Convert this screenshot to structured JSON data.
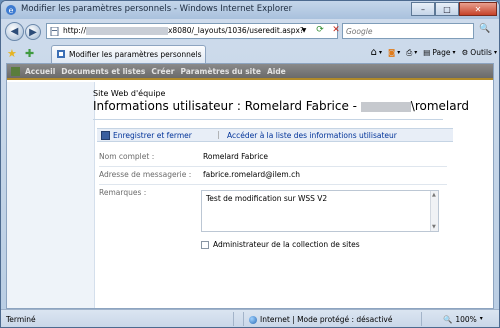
{
  "window": {
    "title": "Modifier les paramètres personnels - Windows Internet Explorer",
    "minimize_glyph": "–",
    "maximize_glyph": "□",
    "close_glyph": "✕"
  },
  "address_bar": {
    "url_prefix": "http://",
    "url_suffix": "x8080/_layouts/1036/useredit.aspx?",
    "search_placeholder": "Google"
  },
  "tab": {
    "label": "Modifier les paramètres personnels"
  },
  "tools": {
    "page": "Page",
    "tools": "Outils"
  },
  "top_nav": {
    "items": [
      "Accueil",
      "Documents et listes",
      "Créer",
      "Paramètres du site",
      "Aide"
    ]
  },
  "page": {
    "site_name": "Site Web d'équipe",
    "title_prefix": "Informations utilisateur : Romelard Fabrice -",
    "title_suffix": "\\romelard"
  },
  "toolbar": {
    "save_label": "Enregistrer et fermer",
    "separator": "|",
    "list_link": "Accéder à la liste des informations utilisateur"
  },
  "form": {
    "full_name_label": "Nom complet :",
    "full_name_value": "Romelard Fabrice",
    "email_label": "Adresse de messagerie :",
    "email_value": "fabrice.romelard@ilem.ch",
    "remarks_label": "Remarques :",
    "remarks_value": "Test de modification sur WSS V2",
    "admin_label": "Administrateur de la collection de sites",
    "admin_checked": false
  },
  "status_bar": {
    "status": "Terminé",
    "zone": "Internet | Mode protégé : désactivé",
    "zoom": "100%"
  },
  "colors": {
    "link": "#003399",
    "nav_bar": "#7a7a7a",
    "nav_accent": "#b08a2a"
  }
}
